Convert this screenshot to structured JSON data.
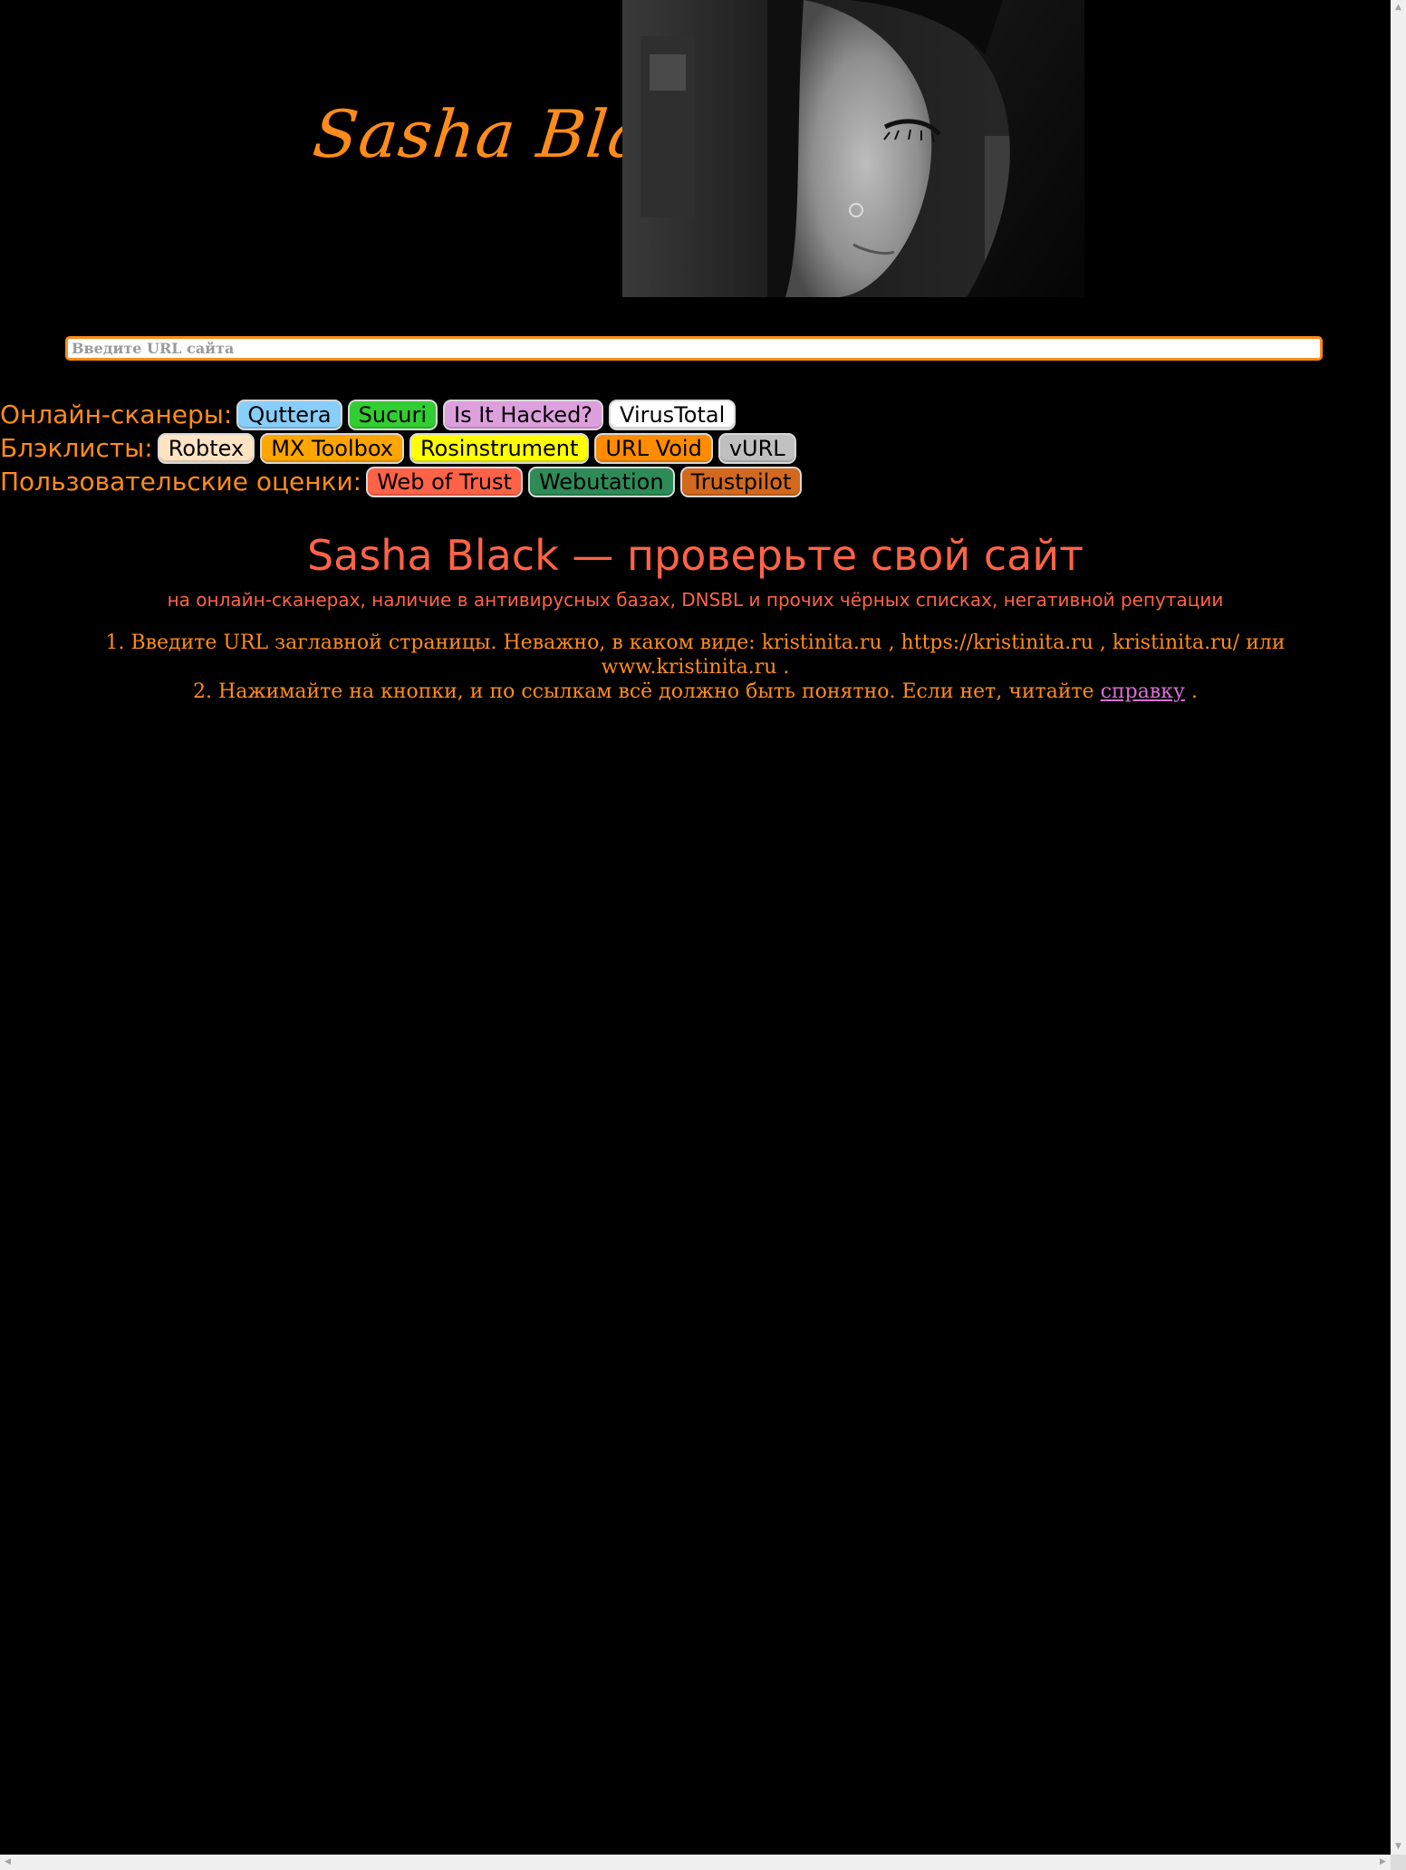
{
  "header": {
    "logo_text": "Sasha Black"
  },
  "search": {
    "placeholder": "Введите URL сайта",
    "value": ""
  },
  "rows": {
    "scanners": {
      "label": "Онлайн-сканеры:",
      "buttons": [
        {
          "label": "Quttera",
          "color": "#87cefa"
        },
        {
          "label": "Sucuri",
          "color": "#32cd32"
        },
        {
          "label": "Is It Hacked?",
          "color": "#dda0dd"
        },
        {
          "label": "VirusTotal",
          "color": "#ffffff"
        }
      ]
    },
    "blacklists": {
      "label": "Блэклисты:",
      "buttons": [
        {
          "label": "Robtex",
          "color": "#ffe4c4"
        },
        {
          "label": "MX Toolbox",
          "color": "#ffa500"
        },
        {
          "label": "Rosinstrument",
          "color": "#ffff00"
        },
        {
          "label": "URL Void",
          "color": "#ff8c00"
        },
        {
          "label": "vURL",
          "color": "#c0c0c0"
        }
      ]
    },
    "ratings": {
      "label": "Пользовательские оценки:",
      "buttons": [
        {
          "label": "Web of Trust",
          "color": "#ff6347"
        },
        {
          "label": "Webutation",
          "color": "#2e8b57"
        },
        {
          "label": "Trustpilot",
          "color": "#d2691e"
        }
      ]
    }
  },
  "main": {
    "title": "Sasha Black — проверьте свой сайт",
    "subtitle": "на онлайн-сканерах, наличие в антивирусных базах, DNSBL и прочих чёрных списках, негативной репутации",
    "line1": "1. Введите URL заглавной страницы. Неважно, в каком виде: kristinita.ru , https://kristinita.ru , kristinita.ru/ или www.kristinita.ru .",
    "line2_before": "2. Нажимайте на кнопки, и по ссылкам всё должно быть понятно. Если нет, читайте ",
    "line2_link": "справку",
    "line2_after": " ."
  },
  "colors": {
    "accent": "#ff8c1a",
    "title": "#ff6347",
    "link": "#da70d6",
    "background": "#000000"
  },
  "icons": {
    "scroll_up": "▲",
    "scroll_down": "▼",
    "scroll_left": "◀",
    "scroll_right": "▶"
  }
}
